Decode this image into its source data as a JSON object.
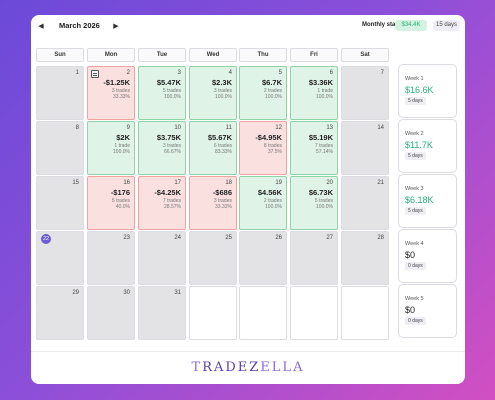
{
  "header": {
    "prev_icon": "chevron-left-icon",
    "next_icon": "chevron-right-icon",
    "month": "March 2026",
    "stats_label": "Monthly stats:",
    "stats_value": "$34.4K",
    "days_value": "15 days"
  },
  "weekdays": [
    "Sun",
    "Mon",
    "Tue",
    "Wed",
    "Thu",
    "Fri",
    "Sat"
  ],
  "days": [
    {
      "day": "1",
      "type": "none"
    },
    {
      "day": "2",
      "type": "loss",
      "pnl": "-$1.25K",
      "trades": "3 trades",
      "winrate": "33.33%",
      "note": true
    },
    {
      "day": "3",
      "type": "win",
      "pnl": "$5.47K",
      "trades": "5 trades",
      "winrate": "100.0%"
    },
    {
      "day": "4",
      "type": "win",
      "pnl": "$2.3K",
      "trades": "3 trades",
      "winrate": "100.0%"
    },
    {
      "day": "5",
      "type": "win",
      "pnl": "$6.7K",
      "trades": "2 trades",
      "winrate": "100.0%"
    },
    {
      "day": "6",
      "type": "win",
      "pnl": "$3.36K",
      "trades": "1 trade",
      "winrate": "100.0%"
    },
    {
      "day": "7",
      "type": "none"
    },
    {
      "day": "8",
      "type": "none"
    },
    {
      "day": "9",
      "type": "win",
      "pnl": "$2K",
      "trades": "1 trade",
      "winrate": "100.0%"
    },
    {
      "day": "10",
      "type": "win",
      "pnl": "$3.75K",
      "trades": "3 trades",
      "winrate": "66.67%"
    },
    {
      "day": "11",
      "type": "win",
      "pnl": "$5.67K",
      "trades": "6 trades",
      "winrate": "83.33%"
    },
    {
      "day": "12",
      "type": "loss",
      "pnl": "-$4.95K",
      "trades": "8 trades",
      "winrate": "37.5%"
    },
    {
      "day": "13",
      "type": "win",
      "pnl": "$5.19K",
      "trades": "7 trades",
      "winrate": "57.14%"
    },
    {
      "day": "14",
      "type": "none"
    },
    {
      "day": "15",
      "type": "none"
    },
    {
      "day": "16",
      "type": "loss",
      "pnl": "-$176",
      "trades": "5 trades",
      "winrate": "40.0%"
    },
    {
      "day": "17",
      "type": "loss",
      "pnl": "-$4.25K",
      "trades": "7 trades",
      "winrate": "28.57%"
    },
    {
      "day": "18",
      "type": "loss",
      "pnl": "-$686",
      "trades": "3 trades",
      "winrate": "33.33%"
    },
    {
      "day": "19",
      "type": "win",
      "pnl": "$4.56K",
      "trades": "2 trades",
      "winrate": "100.0%"
    },
    {
      "day": "20",
      "type": "win",
      "pnl": "$6.73K",
      "trades": "5 trades",
      "winrate": "100.0%"
    },
    {
      "day": "21",
      "type": "none"
    },
    {
      "day": "22",
      "type": "today"
    },
    {
      "day": "23",
      "type": "none"
    },
    {
      "day": "24",
      "type": "none"
    },
    {
      "day": "25",
      "type": "none"
    },
    {
      "day": "26",
      "type": "none"
    },
    {
      "day": "27",
      "type": "none"
    },
    {
      "day": "28",
      "type": "none"
    },
    {
      "day": "29",
      "type": "none"
    },
    {
      "day": "30",
      "type": "none"
    },
    {
      "day": "31",
      "type": "none"
    },
    {
      "day": "",
      "type": "empty"
    },
    {
      "day": "",
      "type": "empty"
    },
    {
      "day": "",
      "type": "empty"
    },
    {
      "day": "",
      "type": "empty"
    }
  ],
  "weeks": [
    {
      "label": "Week 1",
      "value": "$16.6K",
      "days": "5 days",
      "positive": true
    },
    {
      "label": "Week 2",
      "value": "$11.7K",
      "days": "5 days",
      "positive": true
    },
    {
      "label": "Week 3",
      "value": "$6.18K",
      "days": "5 days",
      "positive": true
    },
    {
      "label": "Week 4",
      "value": "$0",
      "days": "0 days",
      "positive": false
    },
    {
      "label": "Week 5",
      "value": "$0",
      "days": "0 days",
      "positive": false
    }
  ],
  "logo": {
    "text": "TRADEZELLA"
  }
}
